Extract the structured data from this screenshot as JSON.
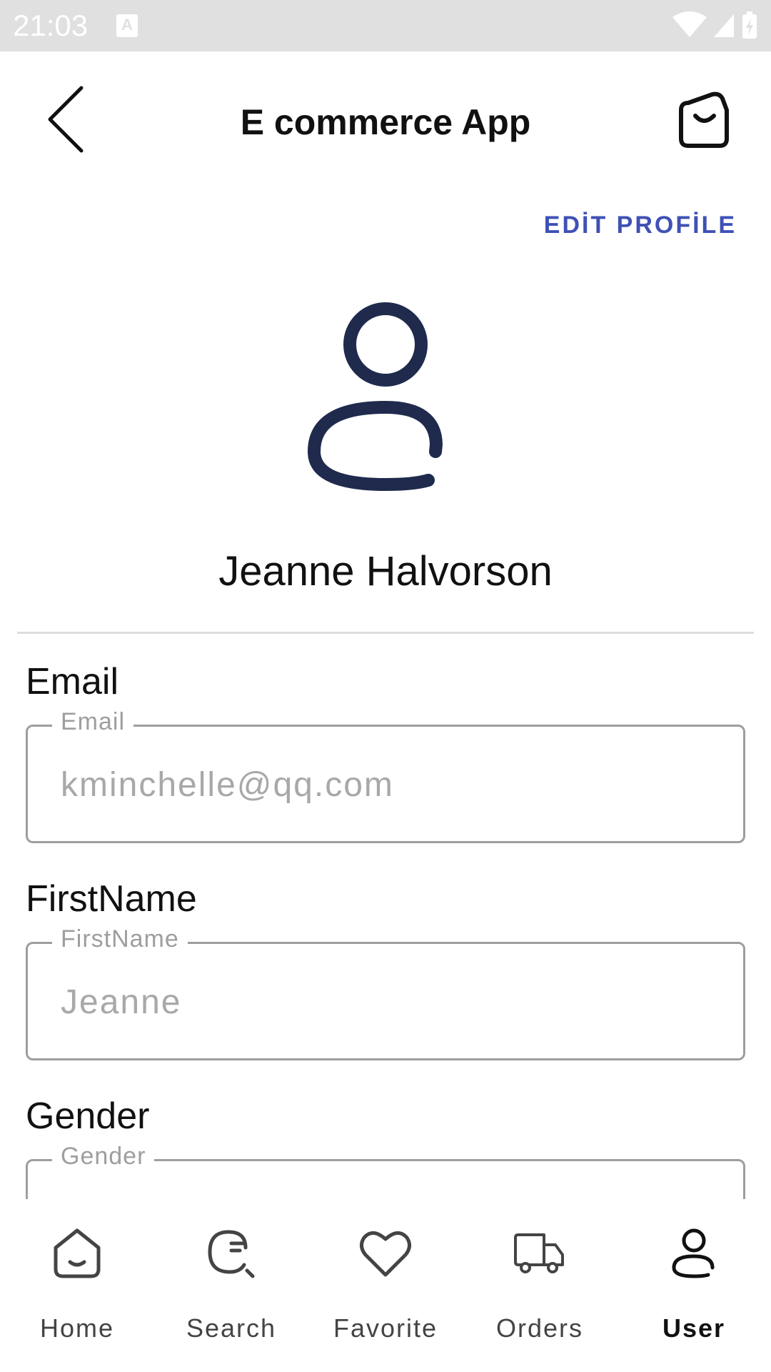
{
  "status_bar": {
    "time": "21:03",
    "indicator": "A",
    "icons": [
      "wifi-icon",
      "signal-icon",
      "battery-charging-icon"
    ]
  },
  "app_bar": {
    "title": "E commerce App",
    "back_icon": "chevron-left-icon",
    "cart_icon": "shopping-bag-icon"
  },
  "profile": {
    "edit_label": "EDİT PROFİLE",
    "avatar_icon": "user-icon",
    "name": "Jeanne Halvorson"
  },
  "fields": {
    "email": {
      "label": "Email",
      "legend": "Email",
      "value": "kminchelle@qq.com"
    },
    "first_name": {
      "label": "FirstName",
      "legend": "FirstName",
      "value": "Jeanne"
    },
    "gender": {
      "label": "Gender",
      "legend": "Gender",
      "value": ""
    }
  },
  "bottom_nav": {
    "items": [
      {
        "label": "Home",
        "icon": "home-icon"
      },
      {
        "label": "Search",
        "icon": "search-icon"
      },
      {
        "label": "Favorite",
        "icon": "heart-icon"
      },
      {
        "label": "Orders",
        "icon": "truck-icon"
      },
      {
        "label": "User",
        "icon": "user-icon"
      }
    ],
    "active": "User"
  },
  "colors": {
    "accent": "#3f51b5",
    "avatar": "#1f2a4d",
    "status_bar": "#e0e0e0"
  }
}
